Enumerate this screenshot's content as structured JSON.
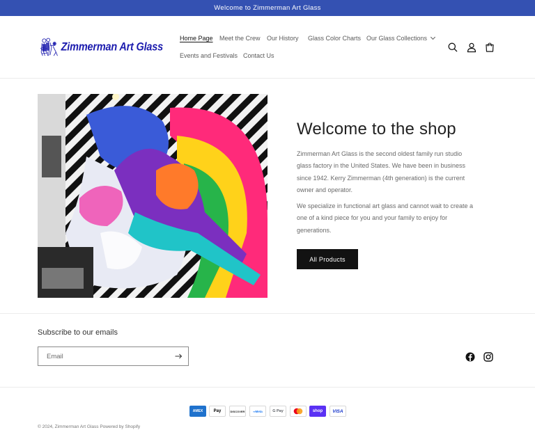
{
  "announcement": "Welcome to Zimmerman Art Glass",
  "logo": {
    "text": "Zimmerman Art Glass"
  },
  "nav": {
    "home": "Home Page",
    "crew": "Meet the Crew",
    "history": "Our History",
    "charts": "Glass Color Charts",
    "collections": "Our Glass Collections",
    "events": "Events and Festivals",
    "contact": "Contact Us"
  },
  "header_icons": [
    "search-icon",
    "account-icon",
    "cart-icon"
  ],
  "hero": {
    "title": "Welcome to the shop",
    "paragraph1": "Zimmerman Art Glass is the second oldest family run studio glass factory in the United States. We have been in business since 1942. Kerry Zimmerman (4th generation) is the current owner and operator.",
    "paragraph2": "We specialize in functional art glass and cannot wait to create a one of a kind piece for you and your family to enjoy for generations.",
    "button": "All Products"
  },
  "newsletter": {
    "title": "Subscribe to our emails",
    "placeholder": "Email"
  },
  "social": [
    "facebook-icon",
    "instagram-icon"
  ],
  "payments": {
    "amex": "AMEX",
    "applepay": "Pay",
    "discover": "DISCOVER",
    "meta": "Meta",
    "gpay": "G Pay",
    "shop": "shop",
    "visa": "VISA"
  },
  "footer": {
    "copyright": "© 2024, Zimmerman Art Glass Powered by Shopify"
  },
  "colors": {
    "announcement_bg": "#3451b2",
    "logo": "#1c1cae",
    "button_bg": "#121212",
    "shop_pay": "#5a31f4"
  }
}
